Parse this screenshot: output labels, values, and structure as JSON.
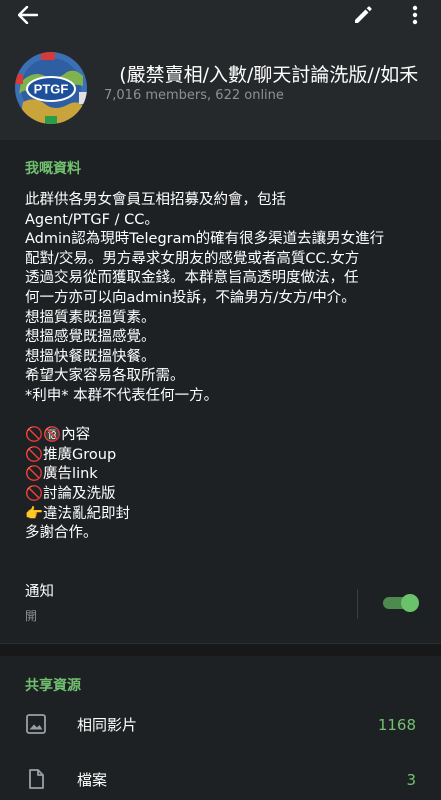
{
  "header": {
    "group_name": "(嚴禁賣相/入數/聊天討論洗版//如禾",
    "stats": "7,016 members, 622 online",
    "avatar_text": "PTGF",
    "icons": {
      "back": "arrow-left-icon",
      "edit": "pencil-icon",
      "more": "more-vertical-icon"
    }
  },
  "description": {
    "title": "我嘅資料",
    "lines": [
      "此群供各男女會員互相招募及約會，包括",
      "Agent/PTGF / CC。",
      "Admin認為現時Telegram的確有很多渠道去讓男女進行",
      "配對/交易。男方尋求女朋友的感覺或者高質CC.女方",
      "透過交易從而獲取金錢。本群意旨高透明度做法，任",
      "何一方亦可以向admin投訴，不論男方/女方/中介。",
      "想搵質素既搵質素。",
      "想搵感覺既搵感覺。",
      "想搵快餐既搵快餐。",
      "希望大家容易各取所需。",
      "*利申* 本群不代表任何一方。",
      "",
      "🚫🔞內容",
      "🚫推廣Group",
      "🚫廣告link",
      "🚫討論及洗版",
      "👉違法亂紀即封",
      "多謝合作。"
    ]
  },
  "notifications": {
    "label": "通知",
    "status": "開",
    "enabled": true
  },
  "shared": {
    "title": "共享資源",
    "items": [
      {
        "label": "相同影片",
        "count": "1168",
        "icon": "image-icon"
      },
      {
        "label": "檔案",
        "count": "3",
        "icon": "file-icon"
      }
    ]
  },
  "colors": {
    "accent": "#70c070",
    "header_bg": "#25292b",
    "card_bg": "#1e2123",
    "page_bg": "#181818",
    "toggle_on": "#6ac26a"
  }
}
